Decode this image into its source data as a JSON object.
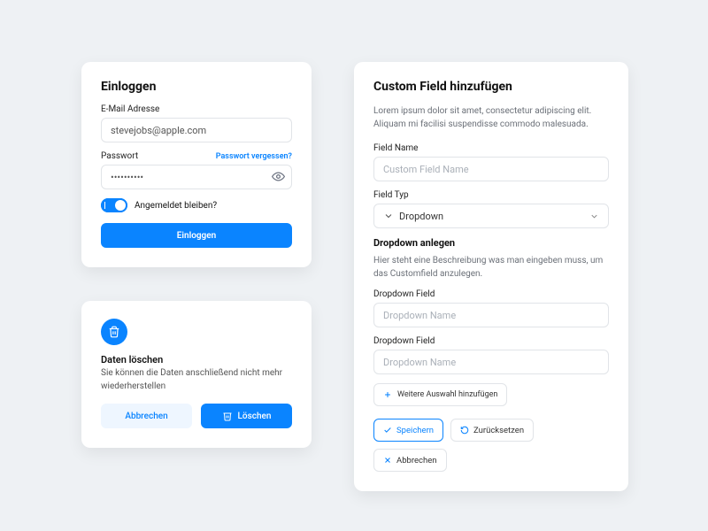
{
  "login": {
    "title": "Einloggen",
    "emailLabel": "E-Mail Adresse",
    "emailValue": "stevejobs@apple.com",
    "passwordLabel": "Passwort",
    "forgot": "Passwort vergessen?",
    "passwordValue": "••••••••••",
    "stayLabel": "Angemeldet bleiben?",
    "submit": "Einloggen"
  },
  "custom": {
    "title": "Custom Field hinzufügen",
    "desc": "Lorem ipsum dolor sit amet, consectetur adipiscing elit. Aliquam mi facilisi suspendisse commodo malesuada.",
    "fieldNameLabel": "Field Name",
    "fieldNamePlaceholder": "Custom Field Name",
    "fieldTypeLabel": "Field Typ",
    "fieldTypeValue": "Dropdown",
    "ddTitle": "Dropdown anlegen",
    "ddDesc": "Hier steht eine Beschreibung was man eingeben muss, um das Customfield anzulegen.",
    "ddFieldLabel": "Dropdown Field",
    "ddPlaceholder": "Dropdown Name",
    "addMore": "Weitere Auswahl hinzufügen",
    "save": "Speichern",
    "reset": "Zurücksetzen",
    "cancel": "Abbrechen"
  },
  "del": {
    "title": "Daten löschen",
    "text": "Sie können die Daten anschließend nicht mehr wiederherstellen",
    "cancel": "Abbrechen",
    "confirm": "Löschen"
  }
}
